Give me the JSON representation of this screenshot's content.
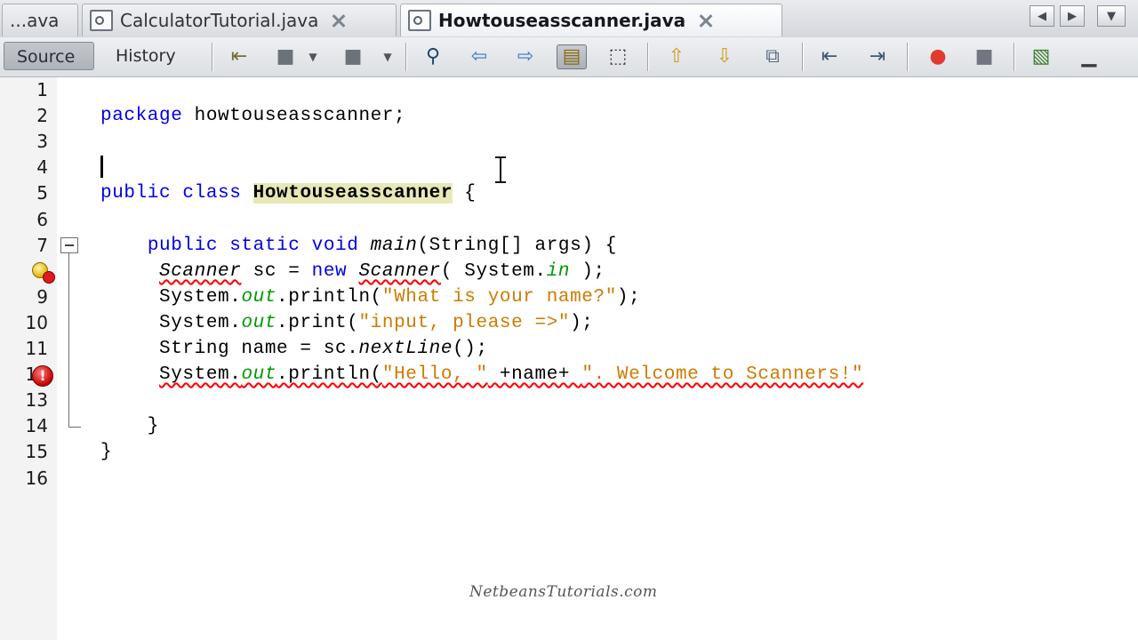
{
  "tabs": [
    {
      "label": "...ava",
      "active": false
    },
    {
      "label": "CalculatorTutorial.java",
      "active": false
    },
    {
      "label": "Howtouseasscanner.java",
      "active": true
    }
  ],
  "toolbar": {
    "source_label": "Source",
    "history_label": "History",
    "icons": [
      "back-to-last-edit-icon",
      "back-icon",
      "forward-icon",
      "find-icon",
      "find-previous-icon",
      "find-next-icon",
      "toggle-highlight-icon",
      "toggle-rect-select-icon",
      "previous-bookmark-icon",
      "next-bookmark-icon",
      "toggle-bookmark-icon",
      "shift-left-icon",
      "shift-right-icon",
      "start-macro-icon",
      "stop-macro-icon",
      "comment-icon",
      "uncomment-icon"
    ]
  },
  "editor": {
    "line_numbers": [
      "1",
      "2",
      "3",
      "4",
      "5",
      "6",
      "7",
      "8",
      "9",
      "10",
      "11",
      "12",
      "13",
      "14",
      "15",
      "16"
    ],
    "current_line": 4,
    "lines": [
      {
        "n": 1,
        "segments": []
      },
      {
        "n": 2,
        "segments": [
          {
            "t": "package",
            "c": "kw"
          },
          {
            "t": " howtouseasscanner;",
            "c": ""
          }
        ]
      },
      {
        "n": 3,
        "segments": []
      },
      {
        "n": 4,
        "segments": []
      },
      {
        "n": 5,
        "segments": [
          {
            "t": "public",
            "c": "kw"
          },
          {
            "t": " ",
            "c": ""
          },
          {
            "t": "class",
            "c": "kw"
          },
          {
            "t": " ",
            "c": ""
          },
          {
            "t": "Howtouseasscanner",
            "c": "cls-hl"
          },
          {
            "t": " {",
            "c": ""
          }
        ]
      },
      {
        "n": 6,
        "segments": []
      },
      {
        "n": 7,
        "segments": [
          {
            "t": "    ",
            "c": ""
          },
          {
            "t": "public",
            "c": "kw"
          },
          {
            "t": " ",
            "c": ""
          },
          {
            "t": "static",
            "c": "kw"
          },
          {
            "t": " ",
            "c": ""
          },
          {
            "t": "void",
            "c": "kw"
          },
          {
            "t": " ",
            "c": ""
          },
          {
            "t": "main",
            "c": "it"
          },
          {
            "t": "(String[] args) {",
            "c": ""
          }
        ]
      },
      {
        "n": 8,
        "segments": [
          {
            "t": "     ",
            "c": ""
          },
          {
            "t": "Scanner",
            "c": "it err"
          },
          {
            "t": " sc = ",
            "c": ""
          },
          {
            "t": "new",
            "c": "kw"
          },
          {
            "t": " ",
            "c": ""
          },
          {
            "t": "Scanner",
            "c": "it err"
          },
          {
            "t": "( System.",
            "c": ""
          },
          {
            "t": "in",
            "c": "fld"
          },
          {
            "t": " );",
            "c": ""
          }
        ]
      },
      {
        "n": 9,
        "segments": [
          {
            "t": "     System.",
            "c": ""
          },
          {
            "t": "out",
            "c": "fld"
          },
          {
            "t": ".println(",
            "c": ""
          },
          {
            "t": "\"What is your name?\"",
            "c": "str"
          },
          {
            "t": ");",
            "c": ""
          }
        ]
      },
      {
        "n": 10,
        "segments": [
          {
            "t": "     System.",
            "c": ""
          },
          {
            "t": "out",
            "c": "fld"
          },
          {
            "t": ".print(",
            "c": ""
          },
          {
            "t": "\"input, please =>\"",
            "c": "str"
          },
          {
            "t": ");",
            "c": ""
          }
        ]
      },
      {
        "n": 11,
        "segments": [
          {
            "t": "     String name = sc.",
            "c": ""
          },
          {
            "t": "nextLine",
            "c": "it"
          },
          {
            "t": "();",
            "c": ""
          }
        ]
      },
      {
        "n": 12,
        "segments": [
          {
            "t": "     ",
            "c": ""
          },
          {
            "t": "System.",
            "c": "err"
          },
          {
            "t": "out",
            "c": "fld err"
          },
          {
            "t": ".println(",
            "c": "err"
          },
          {
            "t": "\"Hello, \"",
            "c": "str err"
          },
          {
            "t": " +name+ ",
            "c": "err"
          },
          {
            "t": "\". Welcome to Scanners!\"",
            "c": "str err"
          }
        ]
      },
      {
        "n": 13,
        "segments": []
      },
      {
        "n": 14,
        "segments": [
          {
            "t": "    }",
            "c": ""
          }
        ]
      },
      {
        "n": 15,
        "segments": [
          {
            "t": "}",
            "c": ""
          }
        ]
      },
      {
        "n": 16,
        "segments": []
      }
    ]
  },
  "watermark": "NetbeansTutorials.com",
  "colors": {
    "keyword": "#0000e6",
    "string": "#ce7b00",
    "field": "#009900",
    "error_underline": "#ff0000",
    "class_highlight": "#e7e8b6"
  }
}
